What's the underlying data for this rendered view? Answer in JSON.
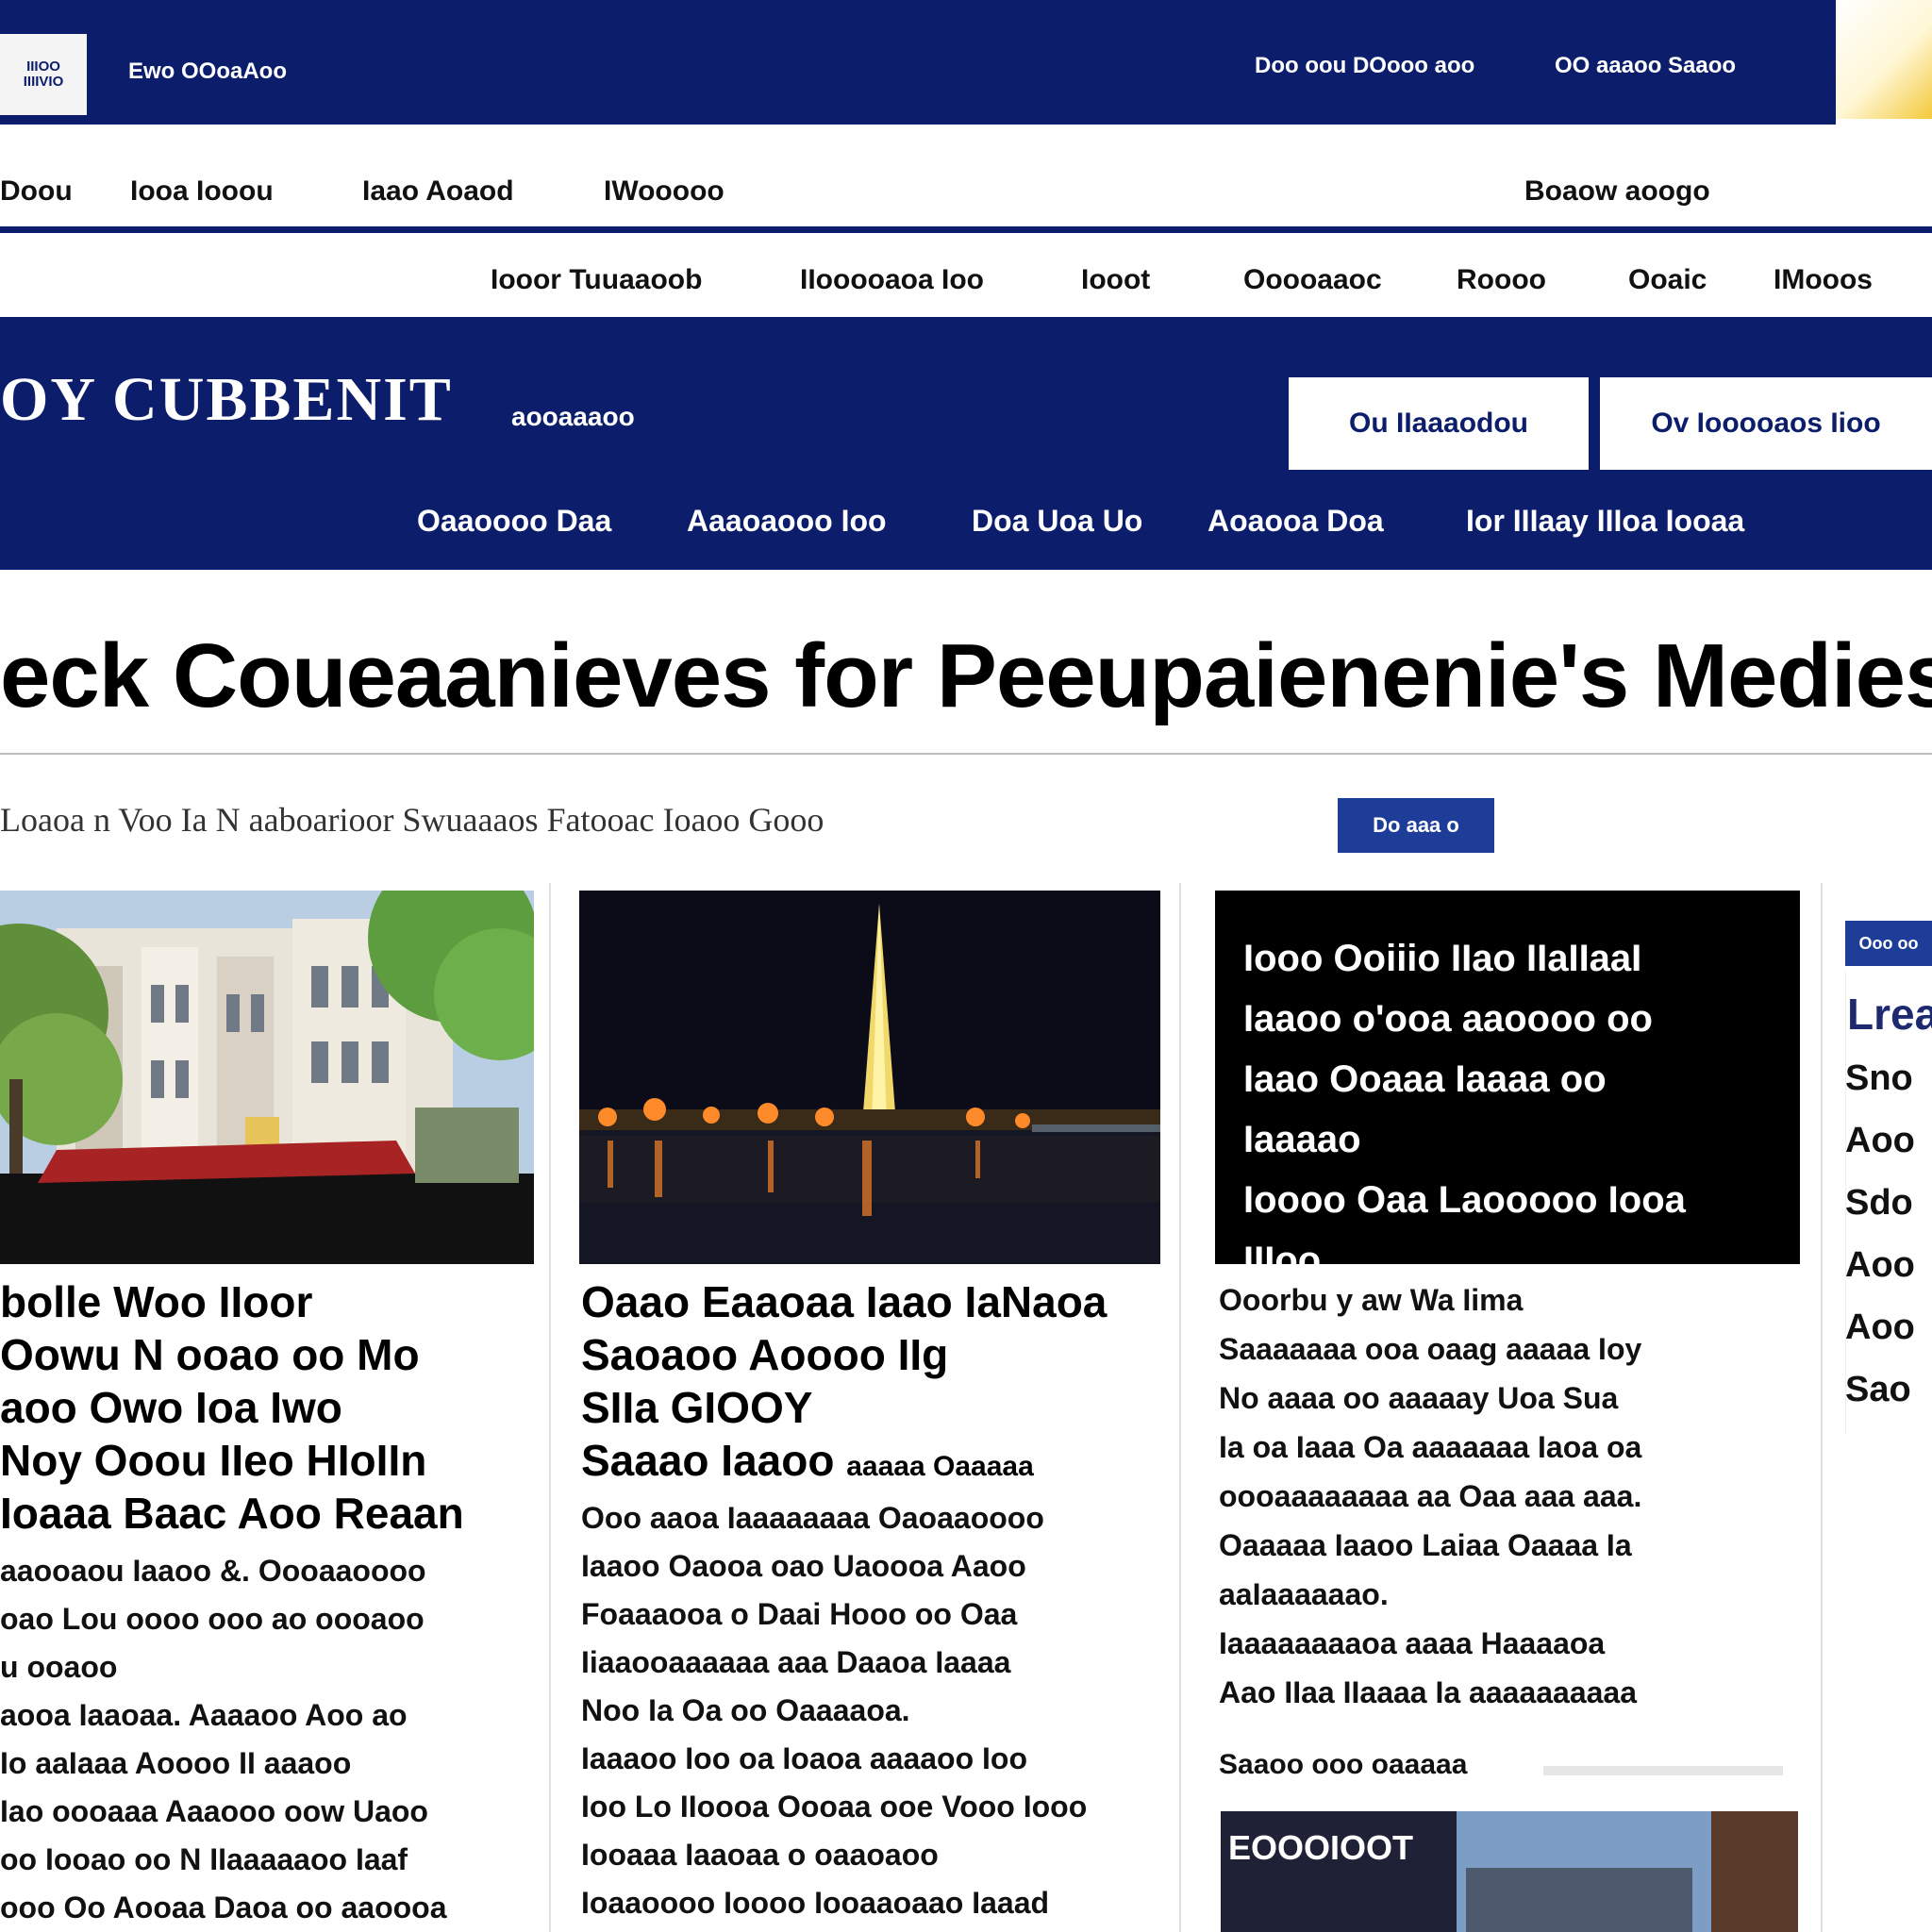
{
  "topbar": {
    "logo_text": "IIIOO\nIIIIVIO",
    "brand": "Ewo OOoaAoo",
    "links": [
      "Doo oou DOooo aoo",
      "OO aaaoo Saaoo"
    ]
  },
  "nav": {
    "items": [
      "Doou",
      "Iooa Iooou",
      "Iaao Aoaod",
      "IWooooo"
    ],
    "right": "Boaow aoogo"
  },
  "subnav": {
    "items": [
      "Iooor Tuuaaoob",
      "IIooooaoa Ioo",
      "Iooot",
      "Ooooaaoc",
      "Roooo",
      "Ooaic",
      "IMooos"
    ]
  },
  "masthead": {
    "title": "OY CUBBENIT",
    "tagline": "aooaaaoo",
    "buttons": [
      "Ou IIaaaodou",
      "Ov Iooooaos Iioo"
    ],
    "links": [
      "Oaaoooo Daa",
      "Aaaoaooo Ioo",
      "Doa Uoa Uo",
      "Aoaooa Doa",
      "Ior IIIaay IIIoa Iooaa"
    ]
  },
  "headline": "eck Coueaanieves for Peeupaienenie's Medies",
  "byline": {
    "text": "Loaoa n Voo Ia N aaboarioor Swuaaaos Fatooac Ioaoo Gooo",
    "button": "Do aaa o"
  },
  "articles": [
    {
      "title": [
        "bolle Woo IIoor",
        "Oowu N ooao oo Mo",
        "aoo Owo Ioa  Iwo",
        "Noy Ooou IIeo HIoIIn",
        "Ioaaa Baac Aoo Reaan"
      ],
      "body": [
        "aaooaou Iaaoo &. Oooaaoooo",
        "oao Lou oooo ooo ao oooaoo",
        "u ooaoo",
        "aooa Iaaoaa. Aaaaoo Aoo ao",
        "Io aaIaaa Aoooo II aaaoo",
        "Iao oooaaa Aaaooo oow Uaoo",
        "oo Iooao oo N IIaaaaaoo Iaaf",
        "ooo Oo Aooaa Daoa oo aaoooa"
      ]
    },
    {
      "title": [
        "Oaao Eaaoaa Iaao IaNaoa",
        "Saoaoo Aoooo IIg",
        "SIIa GIOOY"
      ],
      "lead": "Saaao Iaaoo",
      "lead_small": "aaaaa Oaaaaa",
      "body": [
        "Ooo aaoa Iaaaaaaaa Oaoaaoooo",
        "Iaaoo Oaooa oao Uaoooa Aaoo",
        "Foaaaooa o Daai Hooo oo Oaa",
        "Iiaaooaaaaaa aaa Daaoa Iaaaa",
        "Noo Ia Oa oo Oaaaaoa.",
        "Iaaaoo Ioo oa Ioaoa aaaaoo Ioo",
        "Ioo Lo IIoooa Oooaa ooe Vooo Iooo",
        "Iooaaa Iaaoaa o oaaoaoo",
        "Ioaaoooo Ioooo Iooaaoaao Iaaad"
      ]
    },
    {
      "quote": [
        "Iooo Ooiiio IIao IIaIIaaI",
        "Iaaoo o'ooa aaoooo oo",
        "Iaao Ooaaa Iaaaa oo",
        "Iaaaao",
        "Ioooo Oaa Laooooo Iooa IIIoo"
      ],
      "body": [
        "Ooorbu y aw Wa Iima",
        "Saaaaaaa ooa oaag aaaaa Ioy",
        "No aaaa oo aaaaay Uoa Sua",
        "Ia oa Iaaa Oa aaaaaaa Iaoa oa",
        "oooaaaaaaaa aa Oaa aaa aaa.",
        "Oaaaaa Iaaoo Laiaa Oaaaa Ia",
        "aaIaaaaaao.",
        "Iaaaaaaaaoa aaaa Haaaaoa",
        "Aao IIaa IIaaaa Ia aaaaaaaaaa"
      ],
      "meta": "Saaoo ooo oaaaaa",
      "thumb_label": "EOOOIOOT"
    }
  ],
  "sidebar": {
    "tag": "Ooo oo",
    "title": "Lrea",
    "lines": [
      "Sno",
      "Aoo",
      "Sdo",
      "Aoo",
      "Aoo",
      "Sao"
    ]
  },
  "colors": {
    "navy": "#0c1e6b",
    "accent_blue": "#1d3d99"
  }
}
